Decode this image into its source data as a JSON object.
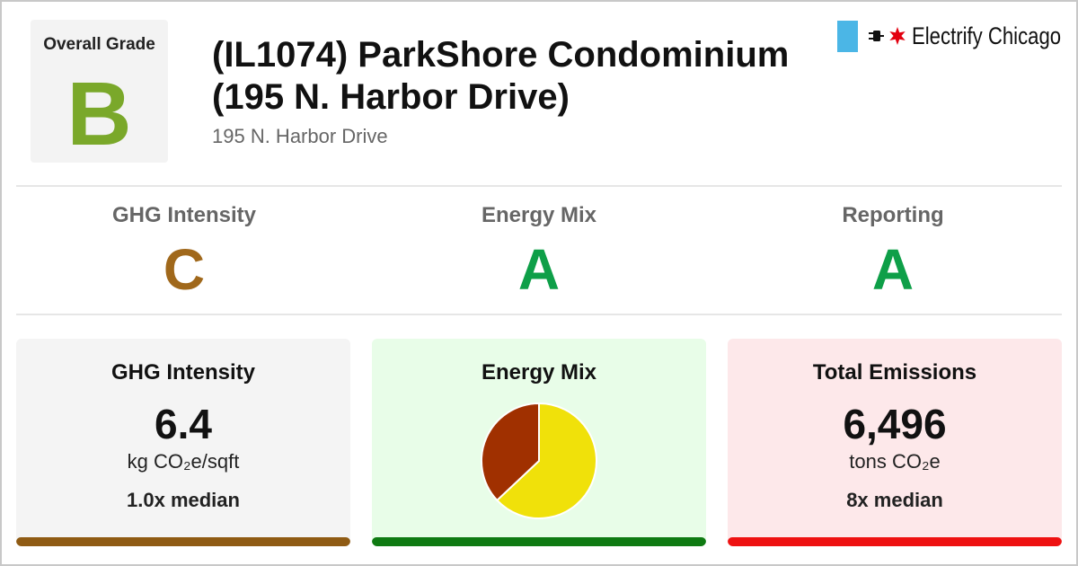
{
  "overall": {
    "label": "Overall Grade",
    "grade": "B",
    "color": "#7aa82a"
  },
  "building": {
    "title": "(IL1074) ParkShore Condominium (195 N. Harbor Drive)",
    "address": "195 N. Harbor Drive"
  },
  "brand": {
    "name": "Electrify Chicago",
    "flag_color": "#4bb6e6",
    "star_color": "#e3000f",
    "icons": [
      "plug-icon",
      "star-icon"
    ]
  },
  "sub_grades": [
    {
      "label": "GHG Intensity",
      "grade": "C",
      "color": "#a0681b"
    },
    {
      "label": "Energy Mix",
      "grade": "A",
      "color": "#0e9f48"
    },
    {
      "label": "Reporting",
      "grade": "A",
      "color": "#0e9f48"
    }
  ],
  "cards": {
    "ghg": {
      "title": "GHG Intensity",
      "value": "6.4",
      "unit": "kg CO₂e/sqft",
      "median": "1.0x median",
      "bg": "#f4f4f4",
      "bar_color": "#8f5b14"
    },
    "mix": {
      "title": "Energy Mix",
      "bg": "#e8fde8",
      "bar_color": "#0f7a12"
    },
    "emissions": {
      "title": "Total Emissions",
      "value": "6,496",
      "unit": "tons CO₂e",
      "median": "8x median",
      "bg": "#fde8ea",
      "bar_color": "#ee1111"
    }
  },
  "chart_data": {
    "type": "pie",
    "series": [
      {
        "value": 63,
        "color": "#f0e10a"
      },
      {
        "value": 37,
        "color": "#a03000"
      }
    ]
  }
}
